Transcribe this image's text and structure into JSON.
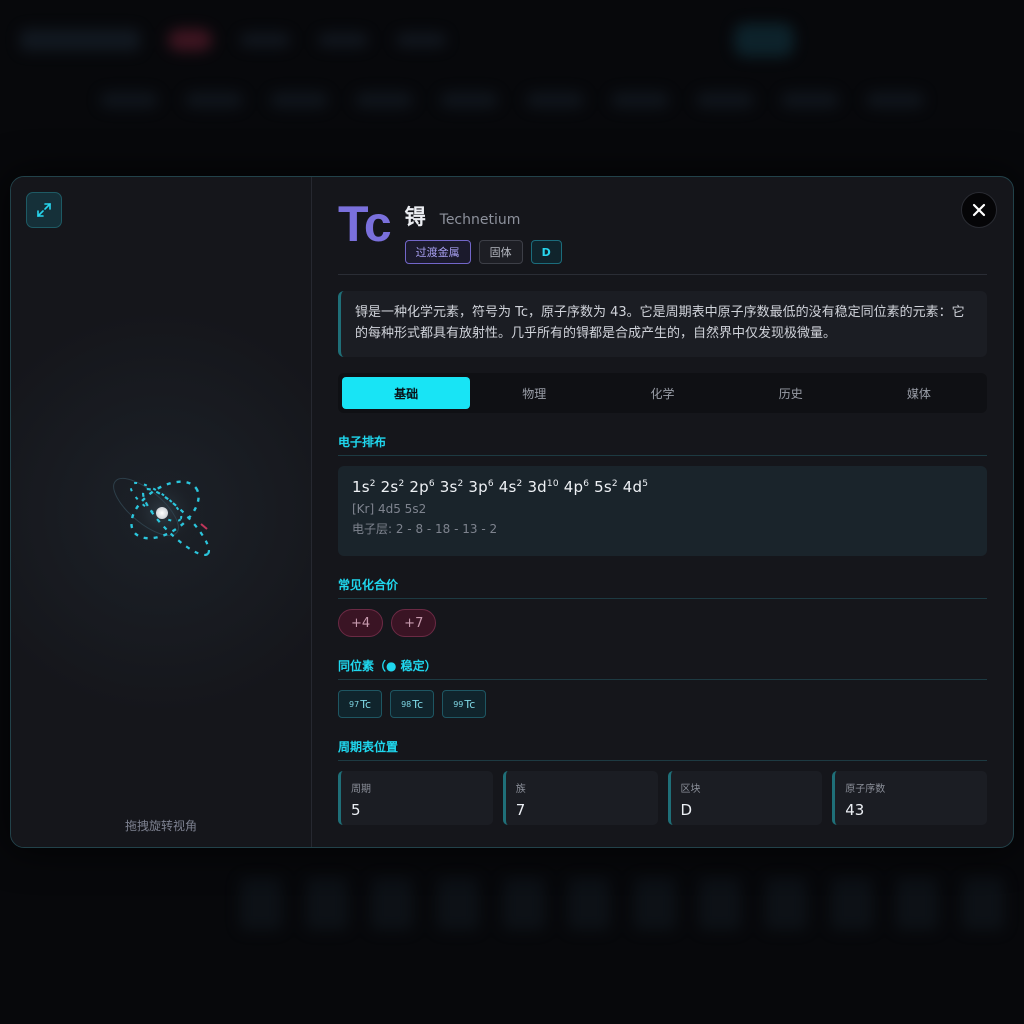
{
  "element": {
    "symbol": "Tc",
    "name_cn": "锝",
    "name_en": "Technetium",
    "badges": [
      "过渡金属",
      "固体",
      "D"
    ],
    "description": "锝是一种化学元素，符号为 Tc，原子序数为 43。它是周期表中原子序数最低的没有稳定同位素的元素：它的每种形式都具有放射性。几乎所有的锝都是合成产生的，自然界中仅发现极微量。"
  },
  "tabs": [
    "基础",
    "物理",
    "化学",
    "历史",
    "媒体"
  ],
  "active_tab": "基础",
  "sections": {
    "electron_config_title": "电子排布",
    "valence_title": "常见化合价",
    "isotopes_title": "同位素（● 稳定）",
    "position_title": "周期表位置"
  },
  "electron_config": {
    "orbitals": [
      {
        "o": "1s",
        "n": "2"
      },
      {
        "o": "2s",
        "n": "2"
      },
      {
        "o": "2p",
        "n": "6"
      },
      {
        "o": "3s",
        "n": "2"
      },
      {
        "o": "3p",
        "n": "6"
      },
      {
        "o": "4s",
        "n": "2"
      },
      {
        "o": "3d",
        "n": "10"
      },
      {
        "o": "4p",
        "n": "6"
      },
      {
        "o": "5s",
        "n": "2"
      },
      {
        "o": "4d",
        "n": "5"
      }
    ],
    "noble_gas": "[Kr] 4d5 5s2",
    "shells": "电子层: 2 - 8 - 18 - 13 - 2"
  },
  "valences": [
    "+4",
    "+7"
  ],
  "isotopes": [
    {
      "mass": "97",
      "symbol": "Tc"
    },
    {
      "mass": "98",
      "symbol": "Tc"
    },
    {
      "mass": "99",
      "symbol": "Tc"
    }
  ],
  "position": [
    {
      "label": "周期",
      "value": "5"
    },
    {
      "label": "族",
      "value": "7"
    },
    {
      "label": "区块",
      "value": "D"
    },
    {
      "label": "原子序数",
      "value": "43"
    }
  ],
  "viewer": {
    "hint": "拖拽旋转视角"
  },
  "colors": {
    "accent": "#18e4f5",
    "symbol": "#7a70dc",
    "valence": "#3a1424"
  },
  "icons": {
    "expand": "expand-icon",
    "close": "close-icon"
  }
}
